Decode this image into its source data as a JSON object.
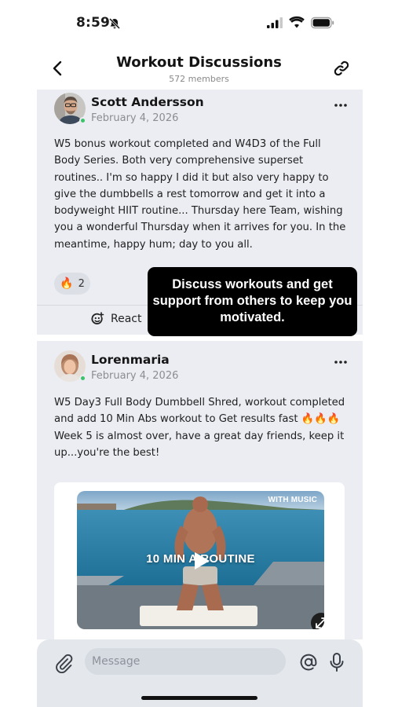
{
  "status_bar": {
    "time": "8:59"
  },
  "header": {
    "title": "Workout Discussions",
    "subtitle": "572 members"
  },
  "posts": [
    {
      "author": "Scott Andersson",
      "date": "February 4, 2026",
      "paragraphs": [
        "W5 bonus workout completed and W4D3 of the Full Body Series. Both very comprehensive superset routines.. I'm so happy I did it but also very happy to give the dumbbells a rest tomorrow and get it into a bodyweight HIIT routine... Thursday here Team, wishing you a wonderful Thursday when it arrives for you. In the meantime, happy hum; day to you all."
      ],
      "reaction": {
        "emoji": "🔥",
        "count": "2"
      },
      "react_label": "React"
    },
    {
      "author": "Lorenmaria",
      "date": "February 4, 2026",
      "paragraphs": [
        "W5 Day3 Full Body Dumbbell Shred, workout completed  and add 10 Min Abs workout to Get results fast 🔥🔥🔥",
        "Week 5 is almost over, have a great day friends, keep it up...you're the best!"
      ],
      "video": {
        "badge": "WITH MUSIC",
        "title": "10 MIN A  ROUTINE"
      }
    }
  ],
  "tooltip": {
    "text": "Discuss workouts and get support from others to keep you motivated."
  },
  "composer": {
    "placeholder": "Message"
  },
  "colors": {
    "feed_bg": "#ebedf2",
    "tooltip_bg": "#000000",
    "online": "#3cc36a"
  }
}
